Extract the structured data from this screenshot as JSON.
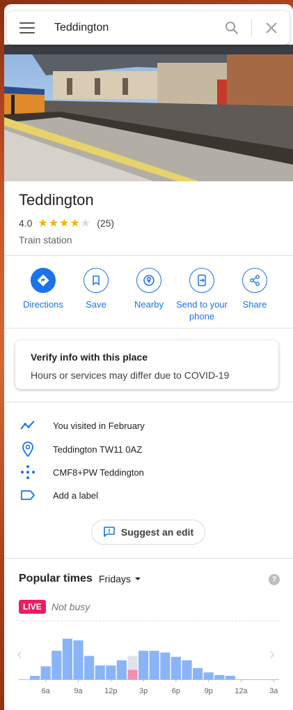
{
  "search": {
    "query": "Teddington"
  },
  "place": {
    "name": "Teddington",
    "rating": "4.0",
    "rating_value": 4,
    "stars_full": "★★★★",
    "stars_empty": "★",
    "review_count": "(25)",
    "category": "Train station"
  },
  "actions": [
    {
      "label": "Directions",
      "icon": "directions-icon"
    },
    {
      "label": "Save",
      "icon": "bookmark-icon"
    },
    {
      "label": "Nearby",
      "icon": "nearby-icon"
    },
    {
      "label": "Send to your phone",
      "icon": "send-to-phone-icon"
    },
    {
      "label": "Share",
      "icon": "share-icon"
    }
  ],
  "covid": {
    "title": "Verify info with this place",
    "text": "Hours or services may differ due to COVID-19"
  },
  "info": [
    {
      "text": "You visited in February",
      "icon": "timeline-icon"
    },
    {
      "text": "Teddington TW11 0AZ",
      "icon": "location-pin-icon"
    },
    {
      "text": "CMF8+PW Teddington",
      "icon": "plus-code-icon"
    },
    {
      "text": "Add a label",
      "icon": "label-icon"
    }
  ],
  "suggest_edit": {
    "label": "Suggest an edit"
  },
  "popular_times": {
    "title": "Popular times",
    "day": "Fridays",
    "live_badge": "LIVE",
    "live_status": "Not busy",
    "colors": {
      "bar": "#8ab4f8",
      "live": "#f48fb1",
      "usual_now": "#e0e3eb",
      "live_badge": "#e91e63",
      "accent": "#1a73e8"
    }
  },
  "chart_data": {
    "type": "bar",
    "title": "",
    "xlabel": "",
    "ylabel": "",
    "tick_labels": [
      "6a",
      "9a",
      "12p",
      "3p",
      "6p",
      "9p",
      "12a",
      "3a"
    ],
    "categories": [
      "5a",
      "6a",
      "7a",
      "8a",
      "9a",
      "10a",
      "11a",
      "12p",
      "1p",
      "2p",
      "3p",
      "4p",
      "5p",
      "6p",
      "7p",
      "8p",
      "9p",
      "10p",
      "11p",
      "12a",
      "1a",
      "2a",
      "3a",
      "4a"
    ],
    "series": [
      {
        "values": [
          4,
          15,
          33,
          47,
          45,
          27,
          16,
          16,
          22,
          27,
          33,
          33,
          31,
          26,
          22,
          13,
          8,
          5,
          4,
          0,
          0,
          0,
          0,
          0
        ]
      }
    ],
    "live": {
      "category": "2p",
      "value": 11
    },
    "ylim": [
      0,
      50
    ]
  }
}
